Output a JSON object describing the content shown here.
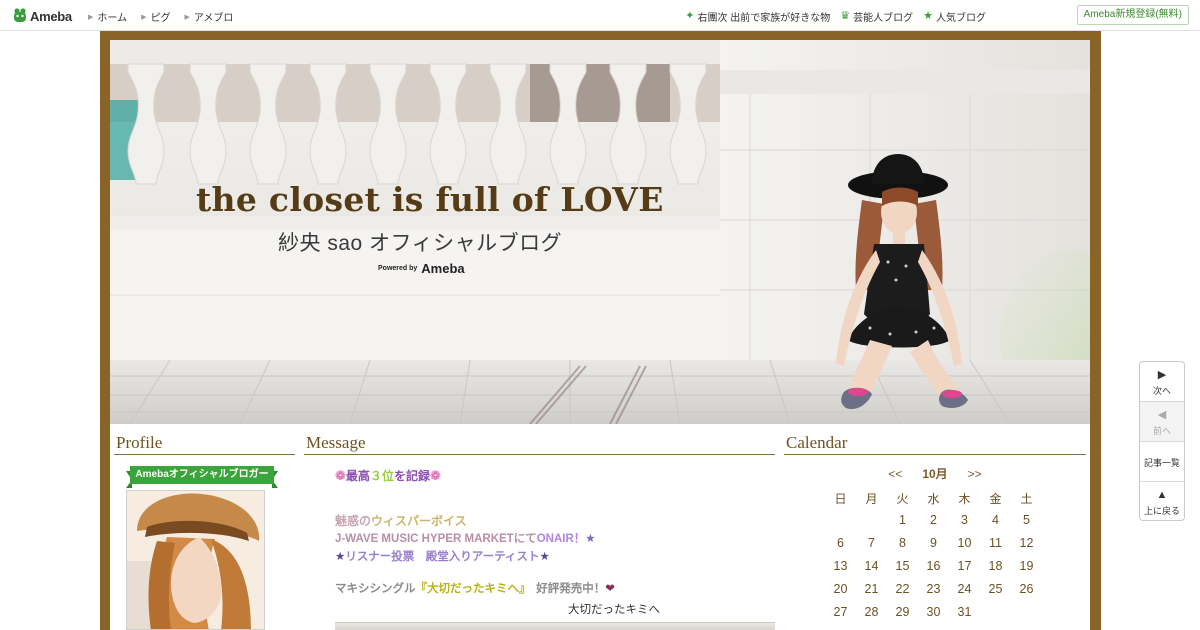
{
  "topbar": {
    "logo_text": "Ameba",
    "nav_left": [
      "ホーム",
      "ピグ",
      "アメブロ"
    ],
    "nav_right": [
      {
        "icon": "clover-icon",
        "label": "右團次 出前で家族が好きな物"
      },
      {
        "icon": "crown-icon",
        "label": "芸能人ブログ"
      },
      {
        "icon": "star-icon",
        "label": "人気ブログ"
      }
    ],
    "register_label": "Ameba新規登録(無料)"
  },
  "header": {
    "title": "the closet is full of LOVE",
    "subtitle": "紗央 sao オフィシャルブログ",
    "powered_by": "Powered by",
    "powered_brand": "Ameba"
  },
  "sidebar": {
    "profile_heading": "Profile",
    "badge_label": "Amebaオフィシャルブロガー"
  },
  "message": {
    "heading": "Message",
    "line1_pre": "最高",
    "line1_num": "３位",
    "line1_post": "を記録",
    "line2_a": "魅惑の",
    "line2_b": "ウィスパーボイス",
    "line3_a": "J-WAVE MUSIC HYPER MARKETにて",
    "line3_b": "ONAIR",
    "line3_c": "！",
    "line3_star": "★",
    "line4_star_l": "★",
    "line4_text": "リスナー投票　殿堂入りアーティスト",
    "line4_star_r": "★",
    "line5_a": "マキシシングル",
    "line5_song": "『大切だったキミへ』",
    "line5_b": "　好評発売中！",
    "line5_heart": "❤",
    "line6": "大切だったキミへ"
  },
  "calendar": {
    "heading": "Calendar",
    "prev": "<<",
    "month": "10月",
    "next": ">>",
    "weekdays": [
      "日",
      "月",
      "火",
      "水",
      "木",
      "金",
      "土"
    ],
    "weeks": [
      [
        "",
        "",
        "1",
        "2",
        "3",
        "4",
        "5"
      ],
      [
        "6",
        "7",
        "8",
        "9",
        "10",
        "11",
        "12"
      ],
      [
        "13",
        "14",
        "15",
        "16",
        "17",
        "18",
        "19"
      ],
      [
        "20",
        "21",
        "22",
        "23",
        "24",
        "25",
        "26"
      ],
      [
        "27",
        "28",
        "29",
        "30",
        "31",
        "",
        ""
      ]
    ]
  },
  "side_nav": {
    "next": "次へ",
    "prev": "前へ",
    "list": "記事一覧",
    "top": "上に戻る"
  },
  "colors": {
    "frame": "#8a6327",
    "heading": "#6f5222",
    "badge": "#3aa53a",
    "title": "#553b16"
  }
}
